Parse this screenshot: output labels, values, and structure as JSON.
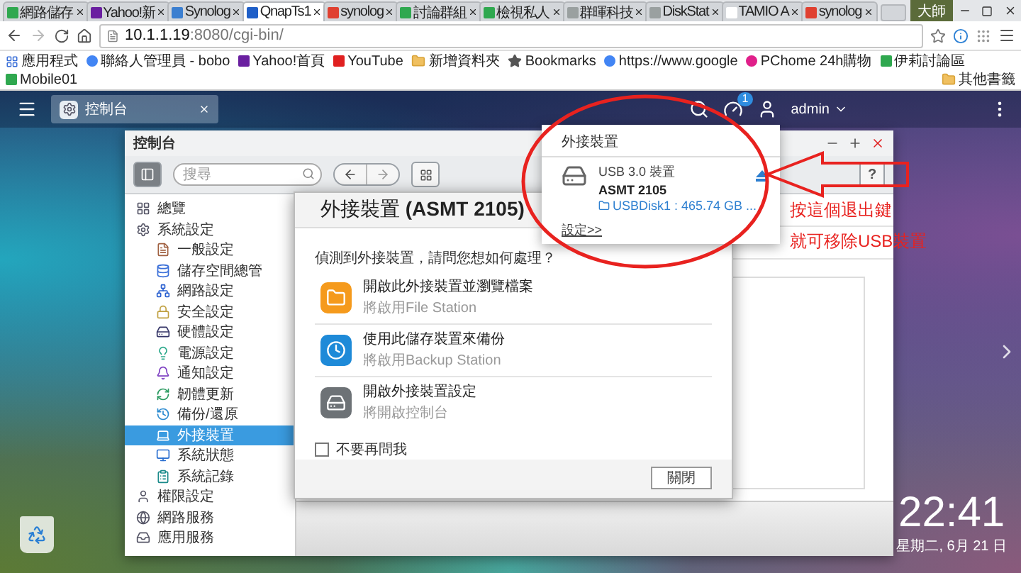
{
  "browser": {
    "tabs": [
      {
        "title": "網路儲存",
        "selected": false
      },
      {
        "title": "Yahoo!新",
        "selected": false
      },
      {
        "title": "Synolog",
        "selected": false
      },
      {
        "title": "QnapTs1",
        "selected": true
      },
      {
        "title": "synolog",
        "selected": false
      },
      {
        "title": "討論群組",
        "selected": false
      },
      {
        "title": "檢視私人",
        "selected": false
      },
      {
        "title": "群暉科技",
        "selected": false
      },
      {
        "title": "DiskStat",
        "selected": false
      },
      {
        "title": "TAMIO A",
        "selected": false
      },
      {
        "title": "synolog",
        "selected": false
      }
    ],
    "profile": "大師",
    "url_host": "10.1.1.19",
    "url_path": ":8080/cgi-bin/",
    "bookmarks": [
      {
        "label": "應用程式",
        "kind": "apps"
      },
      {
        "label": "聯絡人管理員 - bobo",
        "kind": "google"
      },
      {
        "label": "Yahoo!首頁",
        "kind": "yahoo"
      },
      {
        "label": "YouTube",
        "kind": "youtube"
      },
      {
        "label": "新增資料夾",
        "kind": "folder"
      },
      {
        "label": "Bookmarks",
        "kind": "star"
      },
      {
        "label": "https://www.google",
        "kind": "google"
      },
      {
        "label": "PChome 24h購物",
        "kind": "pchome"
      },
      {
        "label": "伊莉討論區",
        "kind": "site"
      },
      {
        "label": "Mobile01",
        "kind": "site"
      }
    ],
    "other_bookmarks": "其他書籤"
  },
  "desktop": {
    "app_tab": "控制台",
    "notification_count": "1",
    "user": "admin"
  },
  "control_panel": {
    "title": "控制台",
    "search_placeholder": "搜尋",
    "help_button": "?",
    "sidebar": [
      {
        "label": "總覽",
        "selected": false
      },
      {
        "label": "系統設定",
        "selected": false,
        "children": [
          {
            "label": "一般設定",
            "selected": false
          },
          {
            "label": "儲存空間總管",
            "selected": false
          },
          {
            "label": "網路設定",
            "selected": false
          },
          {
            "label": "安全設定",
            "selected": false
          },
          {
            "label": "硬體設定",
            "selected": false
          },
          {
            "label": "電源設定",
            "selected": false
          },
          {
            "label": "通知設定",
            "selected": false
          },
          {
            "label": "韌體更新",
            "selected": false
          },
          {
            "label": "備份/還原",
            "selected": false
          },
          {
            "label": "外接裝置",
            "selected": true
          },
          {
            "label": "系統狀態",
            "selected": false
          },
          {
            "label": "系統記錄",
            "selected": false
          }
        ]
      },
      {
        "label": "權限設定",
        "selected": false
      },
      {
        "label": "網路服務",
        "selected": false
      },
      {
        "label": "應用服務",
        "selected": false
      }
    ]
  },
  "dialog": {
    "title": "外接裝置 **(ASMT 2105)**",
    "prompt": "偵測到外接裝置，請問您想如何處理？",
    "options": [
      {
        "kind": "folder",
        "title": "開啟此外接裝置並瀏覽檔案",
        "subtitle": "將啟用File Station"
      },
      {
        "kind": "backup",
        "title": "使用此儲存裝置來備份",
        "subtitle": "將啟用Backup Station"
      },
      {
        "kind": "drive",
        "title": "開啟外接裝置設定",
        "subtitle": "將開啟控制台"
      }
    ],
    "dont_ask": {
      "label": "不要再問我",
      "checked": false
    },
    "close_button": "關閉"
  },
  "popup": {
    "title": "外接裝置",
    "device_type": "USB 3.0 裝置",
    "device_name": "ASMT 2105",
    "volume": "USBDisk1 : 465.74 GB ...",
    "settings_link": "設定>>"
  },
  "annotation": {
    "lines": [
      "按這個退出鍵",
      "就可移除USB裝置"
    ]
  },
  "clock": {
    "time": "22:41",
    "date": "星期二, 6月 21 日"
  }
}
